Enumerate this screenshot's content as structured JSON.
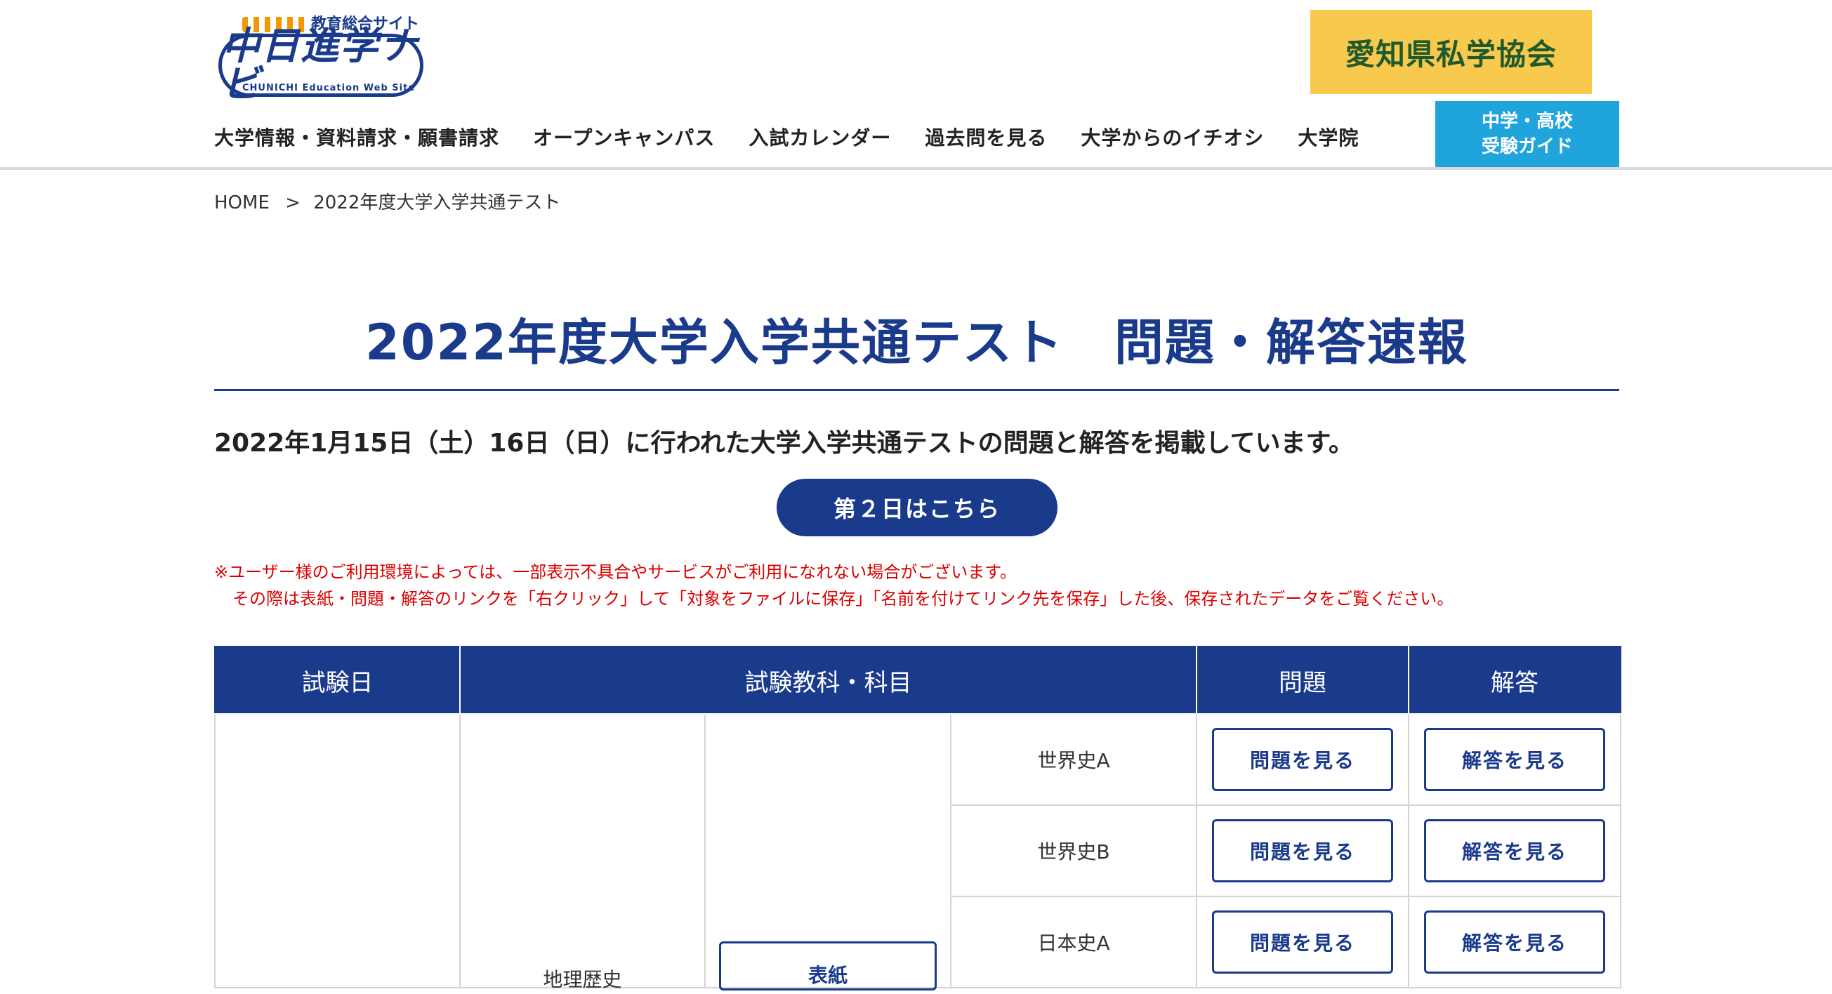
{
  "header": {
    "logo_tagline": "教育総合サイト",
    "logo_text": "中日進学ナビ",
    "logo_subtext": "CHUNICHI Education Web Site",
    "association_banner": "愛知県私学協会",
    "nav": [
      "大学情報・資料請求・願書請求",
      "オープンキャンパス",
      "入試カレンダー",
      "過去問を見る",
      "大学からのイチオシ",
      "大学院"
    ],
    "guide_button": {
      "line1": "中学・高校",
      "line2": "受験ガイド"
    }
  },
  "breadcrumb": {
    "home": "HOME",
    "separator": ">",
    "current": "2022年度大学入学共通テスト"
  },
  "main": {
    "title": "2022年度大学入学共通テスト　問題・解答速報",
    "intro": "2022年1月15日（土）16日（日）に行われた大学入学共通テストの問題と解答を掲載しています。",
    "day2_button": "第２日はこちら",
    "notice_line1": "※ユーザー様のご利用環境によっては、一部表示不具合やサービスがご利用になれない場合がございます。",
    "notice_line2": "その際は表紙・問題・解答のリンクを「右クリック」して「対象をファイルに保存」「名前を付けてリンク先を保存」した後、保存されたデータをご覧ください。"
  },
  "table": {
    "headers": [
      "試験日",
      "試験教科・科目",
      "問題",
      "解答"
    ],
    "group_label": "地理歴史",
    "cover_button": "表紙",
    "rows": [
      {
        "subject": "世界史A",
        "question": "問題を見る",
        "answer": "解答を見る"
      },
      {
        "subject": "世界史B",
        "question": "問題を見る",
        "answer": "解答を見る"
      },
      {
        "subject": "日本史A",
        "question": "問題を見る",
        "answer": "解答を見る"
      }
    ]
  },
  "colors": {
    "brand_navy": "#1a3a8c",
    "banner_yellow": "#f8c94c",
    "guide_blue": "#20a4dc",
    "notice_red": "#d90000"
  }
}
